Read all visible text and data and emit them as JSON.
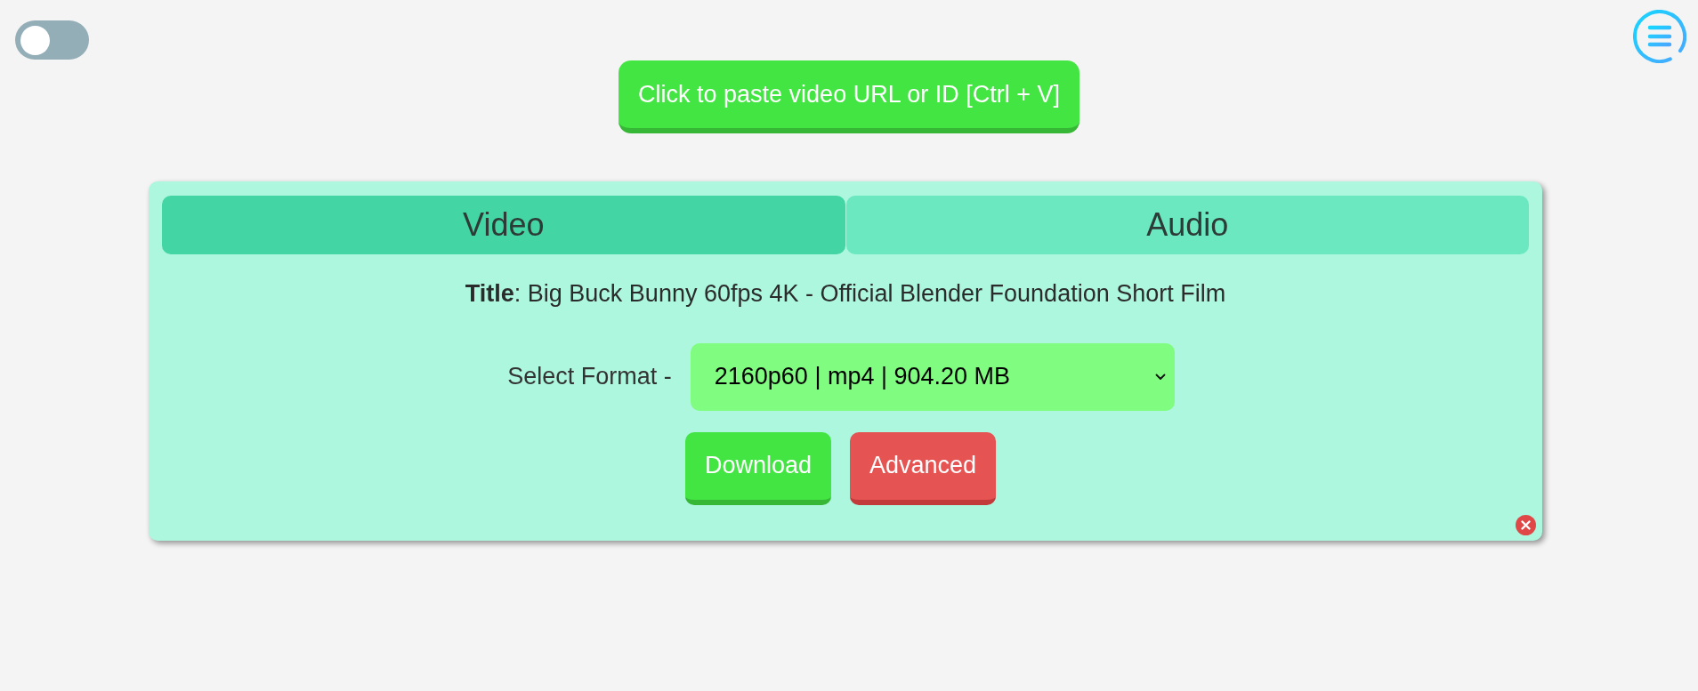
{
  "theme_toggle": {
    "on": false
  },
  "paste_button": {
    "label": "Click to paste video URL or ID [Ctrl + V]"
  },
  "tabs": [
    {
      "label": "Video",
      "selected": true
    },
    {
      "label": "Audio",
      "selected": false
    }
  ],
  "title": "**Title**: Big Buck Bunny 60fps 4K - Official Blender Foundation Short Film",
  "format": {
    "label": "Select Format -",
    "value": "2160p60 | mp4 | 904.20 MB"
  },
  "buttons": [
    {
      "label": "Download",
      "kind": "primary"
    },
    {
      "label": "Advanced",
      "kind": "danger"
    }
  ]
}
